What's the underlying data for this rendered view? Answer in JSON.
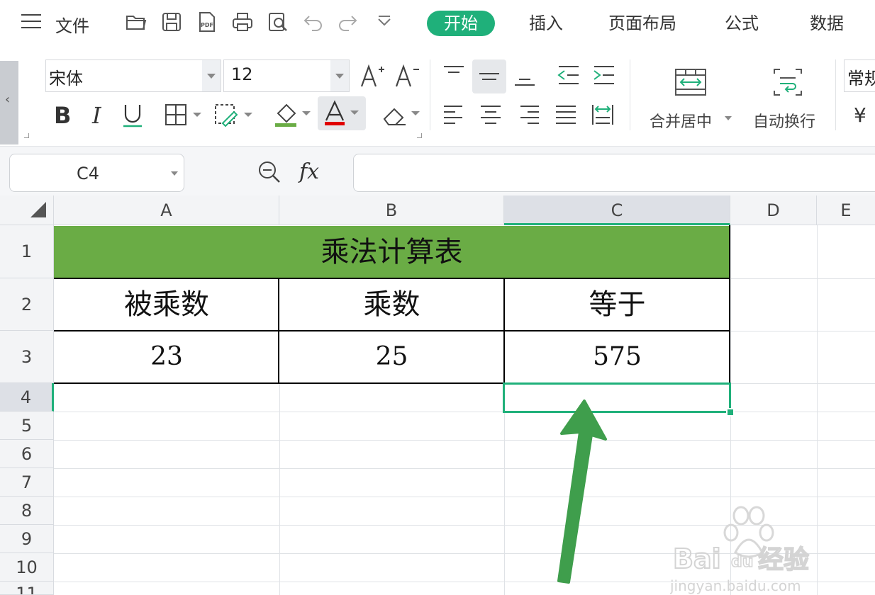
{
  "menubar": {
    "file_label": "文件",
    "tabs": [
      "开始",
      "插入",
      "页面布局",
      "公式",
      "数据"
    ],
    "active_tab": "开始"
  },
  "ribbon": {
    "font_name": "宋体",
    "font_size": "12",
    "merge_center_label": "合并居中",
    "wrap_text_label": "自动换行",
    "number_format": "常规",
    "currency_symbol": "¥",
    "font_color": "#e00000",
    "fill_color": "#6aac45"
  },
  "formula_bar": {
    "cell_ref": "C4",
    "fx_label": "fx",
    "formula": ""
  },
  "sheet": {
    "columns": [
      "A",
      "B",
      "C",
      "D",
      "E"
    ],
    "rows": [
      "1",
      "2",
      "3",
      "4",
      "5",
      "6",
      "7",
      "8",
      "9",
      "10",
      "11"
    ],
    "selected_cell": "C4",
    "title": "乘法计算表",
    "headers": [
      "被乘数",
      "乘数",
      "等于"
    ],
    "values": [
      "23",
      "25",
      "575"
    ]
  },
  "watermark": {
    "text": "Bai 经验",
    "url": "jingyan.baidu.com"
  },
  "colors": {
    "accent": "#1fb07a",
    "title_fill": "#6aac45",
    "arrow": "#3f9e4c"
  }
}
